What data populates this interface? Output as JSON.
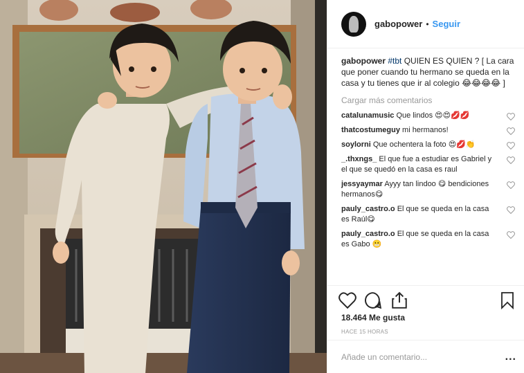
{
  "post": {
    "username": "gabopower",
    "separator": "•",
    "follow_label": "Seguir",
    "caption_user": "gabopower",
    "caption_hashtag": "#tbt",
    "caption_text": " QUIEN ES QUIEN ? [ La cara que poner cuando tu hermano se queda en la casa y tu tienes que ir al colegio 😂😂😂😂 ]",
    "load_more": "Cargar más comentarios",
    "likes": "18.464 Me gusta",
    "time": "HACE 15 HORAS",
    "add_comment_placeholder": "Añade un comentario...",
    "more_label": "..."
  },
  "comments": [
    {
      "user": "catalunamusic",
      "text": " Que lindos 😍😍💋💋"
    },
    {
      "user": "thatcostumeguy",
      "text": " mi hermanos!"
    },
    {
      "user": "soylorni",
      "text": " Que ochentera la foto 😍💋👏"
    },
    {
      "user": "_.thxngs_",
      "text": " El que fue a estudiar es Gabriel y el que se quedó en la casa es raul"
    },
    {
      "user": "jessyaymar",
      "text": " Ayyy tan lindoo 😋 bendiciones hermanos😋"
    },
    {
      "user": "pauly_castro.o",
      "text": " El que se queda en la casa es Raúl😋"
    },
    {
      "user": "pauly_castro.o",
      "text": " El que se queda en la casa es Gabo 😬"
    }
  ],
  "icons": {
    "avatar": "profile-avatar",
    "like": "heart-icon",
    "comment": "comment-bubble-icon",
    "share": "share-icon",
    "save": "bookmark-icon",
    "comment_like": "heart-icon",
    "more": "ellipsis-icon"
  },
  "colors": {
    "link": "#3897f0",
    "hashtag": "#003569",
    "muted": "#999999",
    "text": "#262626",
    "border": "#efefef"
  }
}
